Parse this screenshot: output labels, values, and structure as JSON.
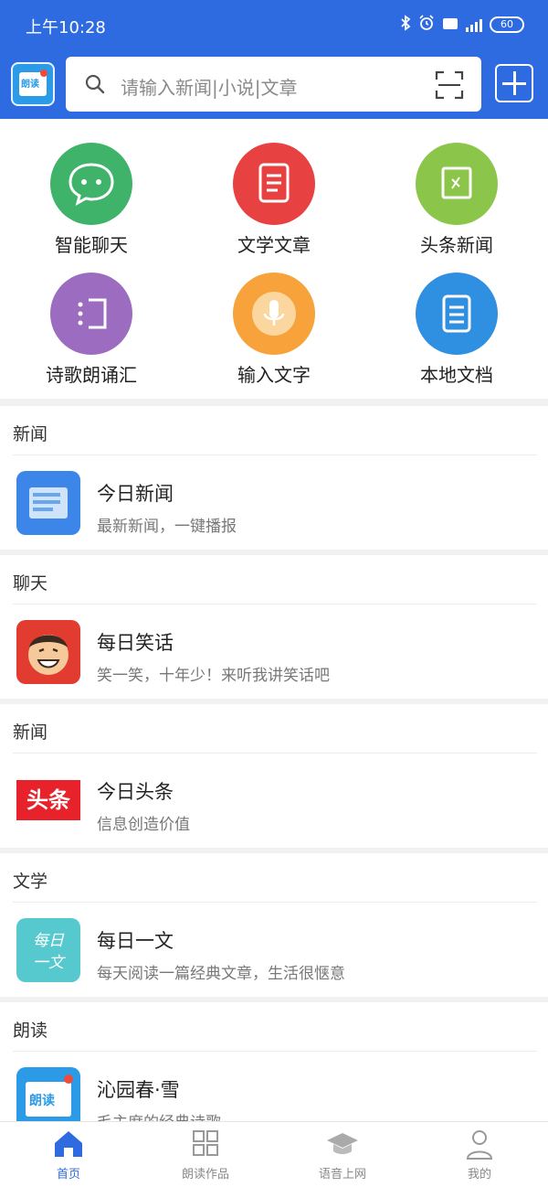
{
  "status": {
    "time": "上午10:28",
    "battery": "60"
  },
  "colors": {
    "brand": "#2f6be0",
    "chat": "#3fb36a",
    "literature": "#e84141",
    "headlines": "#8bc64a",
    "poetry": "#9b6cc0",
    "input": "#f7a23a",
    "local": "#2f8fe0"
  },
  "search": {
    "placeholder": "请输入新闻|小说|文章"
  },
  "grid": [
    {
      "label": "智能聊天",
      "icon": "chat-bubble-icon"
    },
    {
      "label": "文学文章",
      "icon": "article-icon"
    },
    {
      "label": "头条新闻",
      "icon": "headline-icon"
    },
    {
      "label": "诗歌朗诵汇",
      "icon": "poetry-icon"
    },
    {
      "label": "输入文字",
      "icon": "microphone-icon"
    },
    {
      "label": "本地文档",
      "icon": "document-icon"
    }
  ],
  "sections": [
    {
      "title": "新闻",
      "item_title": "今日新闻",
      "item_sub": "最新新闻，一键播报",
      "icon": "newspaper-icon"
    },
    {
      "title": "聊天",
      "item_title": "每日笑话",
      "item_sub": "笑一笑，十年少！来听我讲笑话吧",
      "icon": "laughing-face-icon"
    },
    {
      "title": "新闻",
      "item_title": "今日头条",
      "item_sub": "信息创造价值",
      "icon": "toutiao-logo"
    },
    {
      "title": "文学",
      "item_title": "每日一文",
      "item_sub": "每天阅读一篇经典文章，生活很惬意",
      "icon": "daily-article-icon"
    },
    {
      "title": "朗读",
      "item_title": "沁园春·雪",
      "item_sub": "毛主席的经典诗歌",
      "icon": "reading-book-icon"
    }
  ],
  "logos": {
    "toutiao": "头条",
    "daily_line1": "每日",
    "daily_line2": "一文",
    "app": "朗读"
  },
  "nav": [
    {
      "label": "首页",
      "icon": "home-icon",
      "active": true
    },
    {
      "label": "朗读作品",
      "icon": "grid-apps-icon",
      "active": false
    },
    {
      "label": "语音上网",
      "icon": "graduation-cap-icon",
      "active": false
    },
    {
      "label": "我的",
      "icon": "user-icon",
      "active": false
    }
  ]
}
